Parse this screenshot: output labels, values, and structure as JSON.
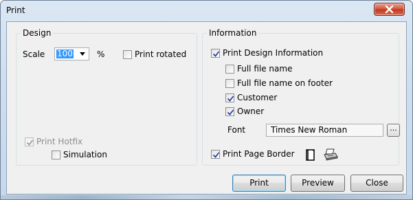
{
  "window": {
    "title": "Print"
  },
  "design": {
    "legend": "Design",
    "scale_label": "Scale",
    "scale_value": "100",
    "percent": "%",
    "print_rotated": "Print rotated",
    "print_hotfix": "Print Hotfix",
    "simulation": "Simulation"
  },
  "information": {
    "legend": "Information",
    "print_design_information": "Print Design Information",
    "full_file_name": "Full file name",
    "full_file_name_on_footer": "Full file name on footer",
    "customer": "Customer",
    "owner": "Owner",
    "font_label": "Font",
    "font_value": "Times New Roman",
    "ellipsis": "...",
    "print_page_border": "Print Page Border"
  },
  "buttons": {
    "print": "Print",
    "preview": "Preview",
    "close": "Close"
  },
  "icons": {
    "close": "close-icon",
    "page": "page-icon",
    "printer": "printer-icon",
    "dropdown": "chevron-down-icon"
  }
}
